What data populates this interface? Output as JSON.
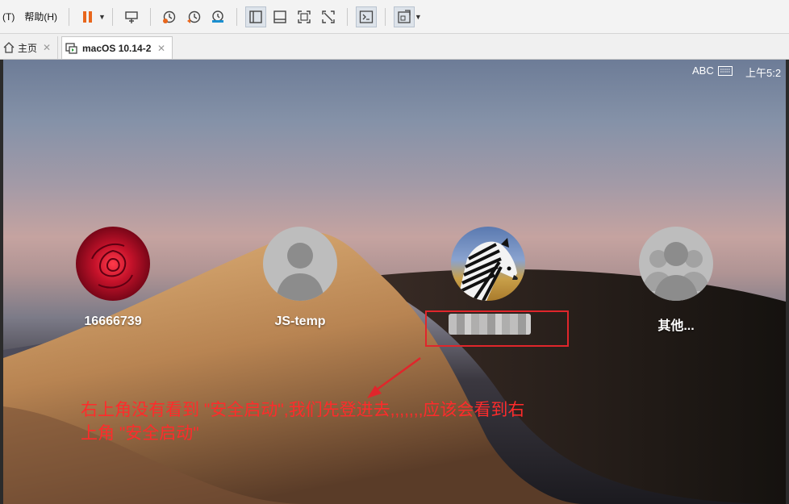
{
  "toolbar": {
    "menu_partial": "(T)",
    "menu_help": "帮助(H)",
    "icons": [
      "pause-icon",
      "send-keys-icon",
      "snapshot-take-icon",
      "snapshot-revert-icon",
      "snapshot-manager-icon",
      "console-view-icon",
      "thumbnail-view-icon",
      "fullscreen-icon",
      "unity-icon",
      "terminal-icon",
      "stretch-icon"
    ]
  },
  "tabs": [
    {
      "label": "主页",
      "icon": "home-icon"
    },
    {
      "label": "macOS 10.14-2",
      "icon": "vm-icon"
    }
  ],
  "vm": {
    "status": {
      "input_source": "ABC",
      "time": "上午5:2"
    },
    "users": [
      {
        "name": "16666739",
        "avatar": "rose"
      },
      {
        "name": "JS-temp",
        "avatar": "default"
      },
      {
        "name": "",
        "avatar": "zebra"
      },
      {
        "name": "其他...",
        "avatar": "other-users"
      }
    ]
  },
  "annotation": {
    "line1": "右上角没有看到 \"安全启动\",我们先登进去,,,,,,,应该会看到右",
    "line2": "上角 \"安全启动\"",
    "color": "#ff2b2b"
  }
}
